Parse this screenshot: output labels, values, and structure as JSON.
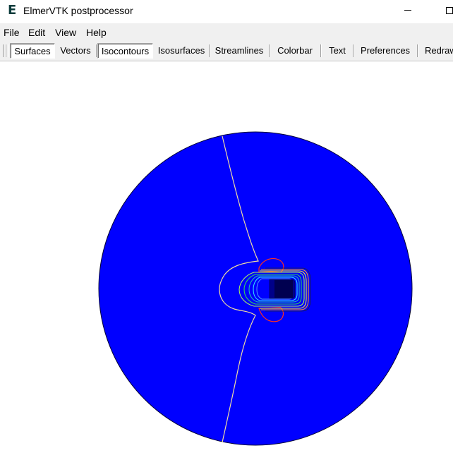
{
  "window": {
    "title": "ElmerVTK postprocessor",
    "icon_letter": "E"
  },
  "menu": {
    "items": [
      "File",
      "Edit",
      "View",
      "Help"
    ]
  },
  "toolbar": {
    "buttons": [
      {
        "label": "Surfaces",
        "pressed": true
      },
      {
        "label": "Vectors",
        "pressed": false
      },
      {
        "label": "Isocontours",
        "pressed": true
      },
      {
        "label": "Isosurfaces",
        "pressed": false
      },
      {
        "label": "Streamlines",
        "pressed": false
      },
      {
        "label": "Colorbar",
        "pressed": false
      },
      {
        "label": "Text",
        "pressed": false
      },
      {
        "label": "Preferences",
        "pressed": false
      },
      {
        "label": "Redraw",
        "pressed": false
      }
    ]
  },
  "colors": {
    "surface": "#0000ff",
    "background": "#ffffff",
    "separatrix": "#e8d8a0"
  }
}
